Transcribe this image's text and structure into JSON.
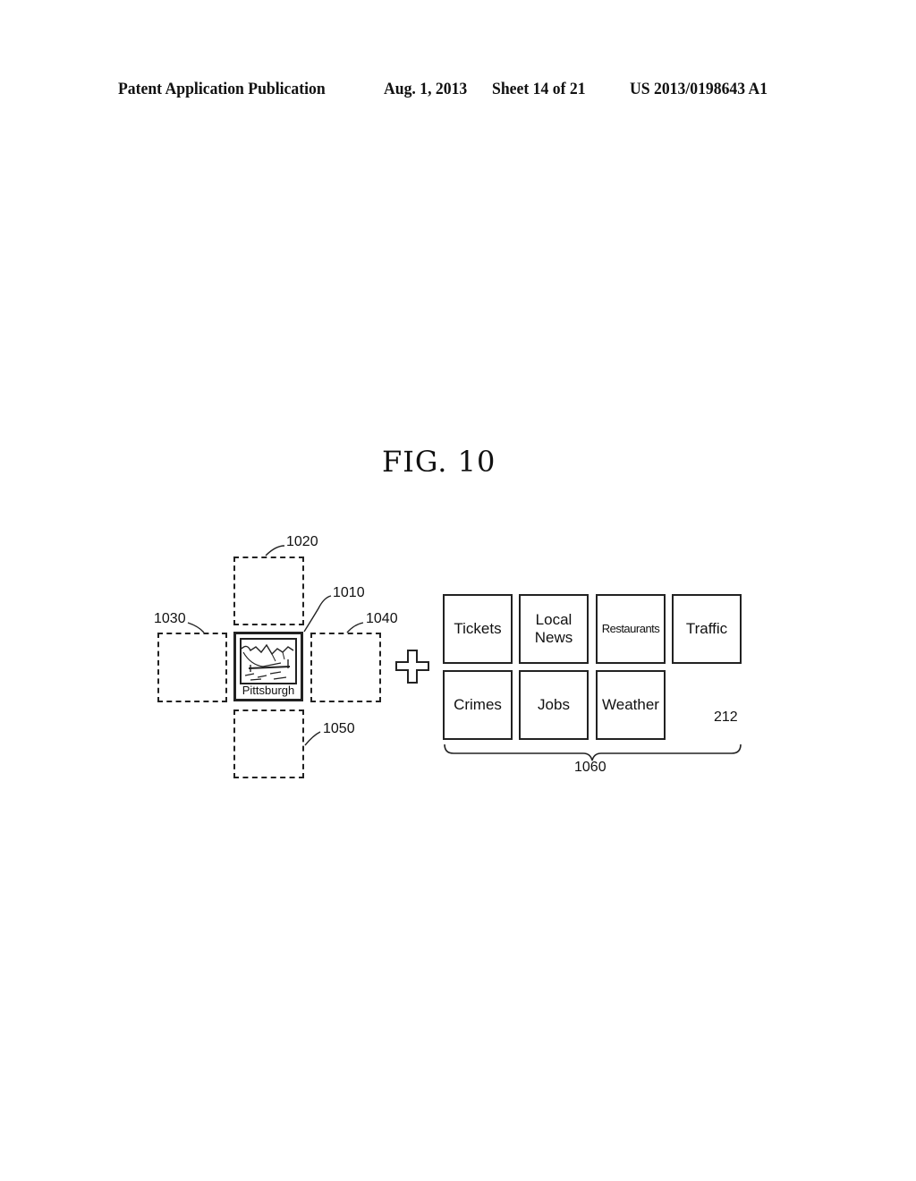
{
  "header": {
    "publication": "Patent Application Publication",
    "date": "Aug. 1, 2013",
    "sheet": "Sheet 14 of 21",
    "number": "US 2013/0198643 A1"
  },
  "figure": {
    "title": "FIG. 10",
    "center_tile": {
      "ref": "1010",
      "label": "Pittsburgh",
      "image": "landscape-mountains-river-icon"
    },
    "dashed_tiles": [
      {
        "ref": "1020",
        "position": "top"
      },
      {
        "ref": "1030",
        "position": "left"
      },
      {
        "ref": "1040",
        "position": "right"
      },
      {
        "ref": "1050",
        "position": "bottom"
      }
    ],
    "operator": "plus-icon",
    "menu_group": {
      "ref": "1060",
      "panel_ref": "212",
      "tiles": [
        "Tickets",
        "Local\nNews",
        "Restaurants",
        "Traffic",
        "Crimes",
        "Jobs",
        "Weather"
      ]
    }
  }
}
